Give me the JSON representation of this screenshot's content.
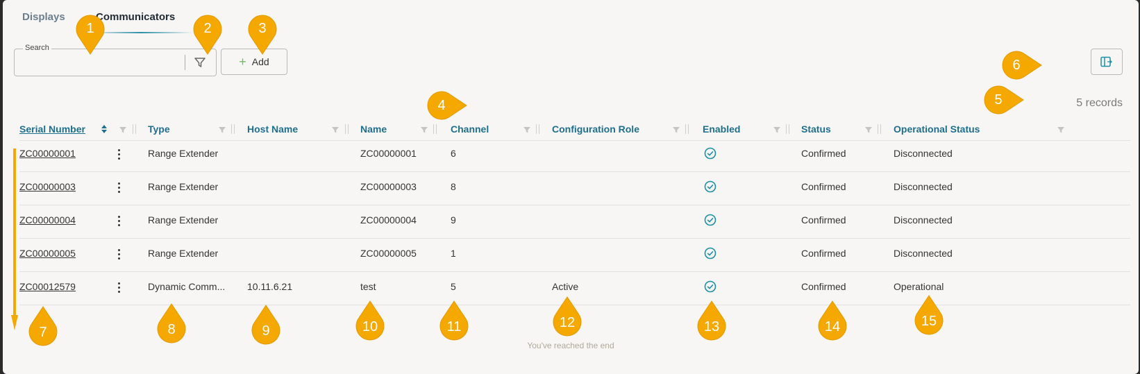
{
  "tabs": [
    {
      "label": "Displays",
      "active": false
    },
    {
      "label": "Communicators",
      "active": true
    }
  ],
  "search": {
    "label": "Search",
    "value": "",
    "placeholder": ""
  },
  "toolbar": {
    "add_label": "Add"
  },
  "records_count": "5 records",
  "columns": [
    {
      "label": "Serial Number",
      "sorted": true
    },
    {
      "label": "Type"
    },
    {
      "label": "Host Name"
    },
    {
      "label": "Name"
    },
    {
      "label": "Channel"
    },
    {
      "label": "Configuration Role"
    },
    {
      "label": "Enabled"
    },
    {
      "label": "Status"
    },
    {
      "label": "Operational Status"
    }
  ],
  "rows": [
    {
      "serial": "ZC00000001",
      "type": "Range Extender",
      "host": "",
      "name": "ZC00000001",
      "channel": "6",
      "role": "",
      "enabled": true,
      "status": "Confirmed",
      "op_status": "Disconnected"
    },
    {
      "serial": "ZC00000003",
      "type": "Range Extender",
      "host": "",
      "name": "ZC00000003",
      "channel": "8",
      "role": "",
      "enabled": true,
      "status": "Confirmed",
      "op_status": "Disconnected"
    },
    {
      "serial": "ZC00000004",
      "type": "Range Extender",
      "host": "",
      "name": "ZC00000004",
      "channel": "9",
      "role": "",
      "enabled": true,
      "status": "Confirmed",
      "op_status": "Disconnected"
    },
    {
      "serial": "ZC00000005",
      "type": "Range Extender",
      "host": "",
      "name": "ZC00000005",
      "channel": "1",
      "role": "",
      "enabled": true,
      "status": "Confirmed",
      "op_status": "Disconnected"
    },
    {
      "serial": "ZC00012579",
      "type": "Dynamic Comm...",
      "host": "10.11.6.21",
      "name": "test",
      "channel": "5",
      "role": "Active",
      "enabled": true,
      "status": "Confirmed",
      "op_status": "Operational"
    }
  ],
  "end_message": "You've reached the end",
  "annotations": [
    "1",
    "2",
    "3",
    "4",
    "5",
    "6",
    "7",
    "8",
    "9",
    "10",
    "11",
    "12",
    "13",
    "14",
    "15"
  ],
  "colors": {
    "accent": "#1e6f8e",
    "pin": "#f5a800",
    "add_plus": "#6cbd5c",
    "check": "#1e8fa8"
  }
}
